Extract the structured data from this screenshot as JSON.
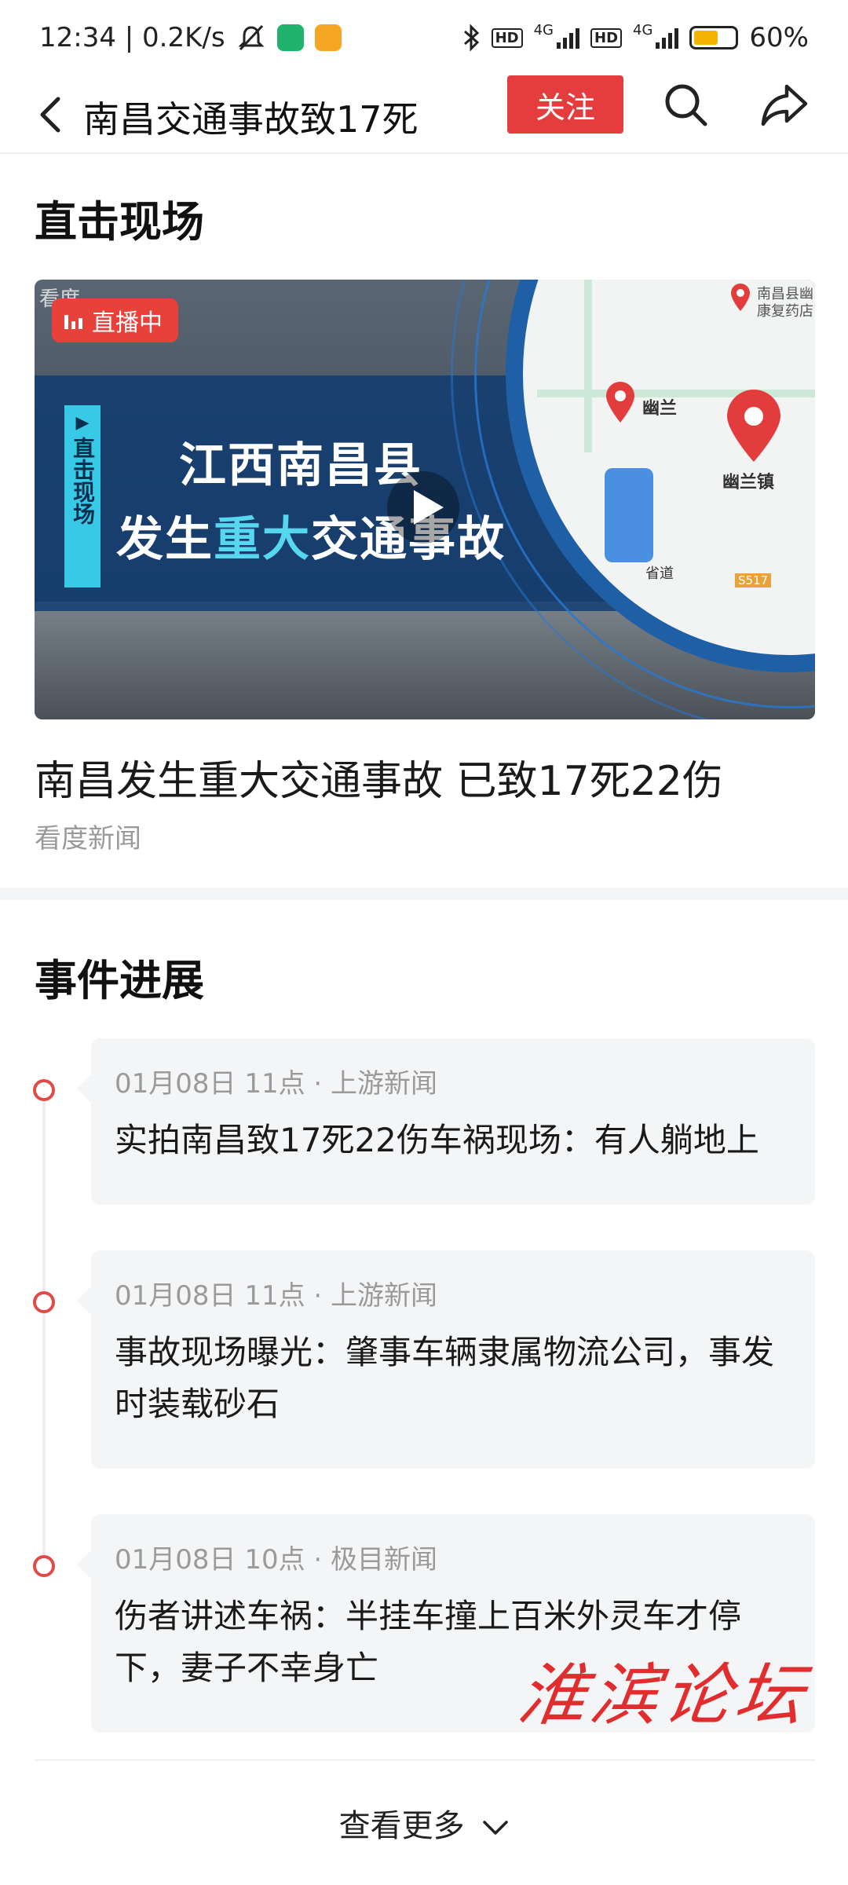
{
  "status_bar": {
    "time_speed": "12:34 | 0.2K/s",
    "network1": "4G",
    "network2": "4G",
    "hd": "HD",
    "battery": "60%",
    "battery_level": 0.6,
    "battery_color": "#f4b400"
  },
  "nav": {
    "title": "南昌交通事故致17死",
    "follow_label": "关注",
    "accent": "#e53d3d"
  },
  "live_section": {
    "heading": "直击现场",
    "video": {
      "live_badge": "直播中",
      "side_tag": "直击现场",
      "overlay_line1": "江西南昌县",
      "overlay_line2_pre": "发生",
      "overlay_line2_hl": "重大",
      "overlay_line2_post": "交通事故",
      "map_labels": [
        "幽兰",
        "幽兰镇",
        "南昌县幽",
        "康复药店",
        "省道",
        "S517"
      ],
      "corner_mark": "看度"
    },
    "headline": "南昌发生重大交通事故 已致17死22伤",
    "source": "看度新闻"
  },
  "progress_section": {
    "heading": "事件进展",
    "items": [
      {
        "meta": "01月08日 11点 · 上游新闻",
        "text": "实拍南昌致17死22伤车祸现场：有人躺地上"
      },
      {
        "meta": "01月08日 11点 · 上游新闻",
        "text": "事故现场曝光：肇事车辆隶属物流公司，事发时装载砂石"
      },
      {
        "meta": "01月08日 10点 · 极目新闻",
        "text": "伤者讲述车祸：半挂车撞上百米外灵车才停下，妻子不幸身亡"
      }
    ],
    "more_label": "查看更多"
  },
  "watermark": "淮滨论坛"
}
